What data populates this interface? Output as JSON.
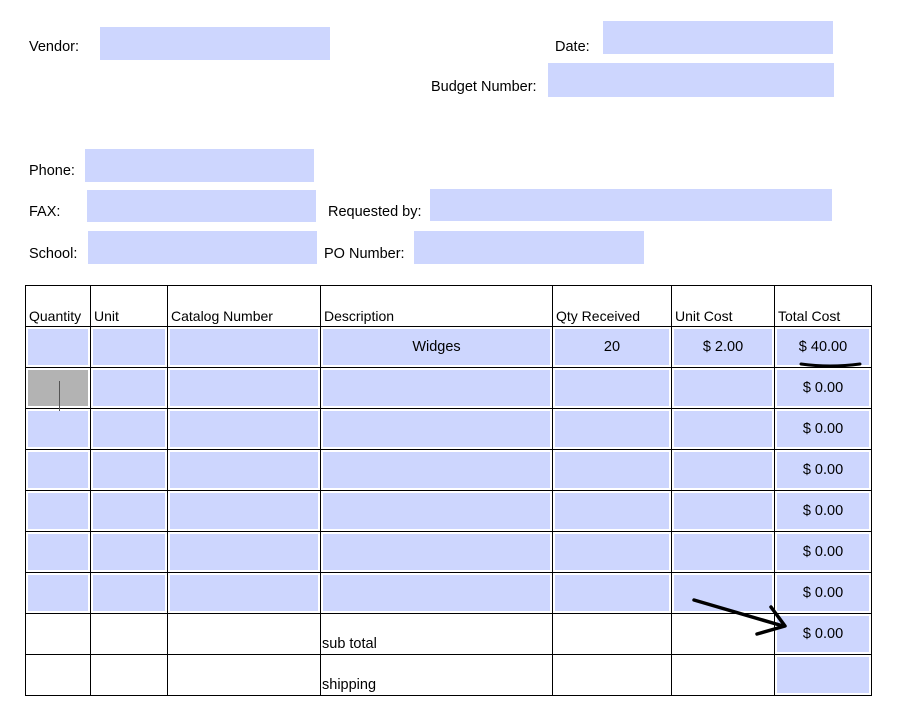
{
  "header": {
    "vendor_label": "Vendor:",
    "date_label": "Date:",
    "budget_label": "Budget Number:",
    "phone_label": "Phone:",
    "fax_label": "FAX:",
    "requested_label": "Requested by:",
    "school_label": "School:",
    "po_label": "PO Number:",
    "vendor_value": "",
    "date_value": "",
    "budget_value": "",
    "phone_value": "",
    "fax_value": "",
    "requested_value": "",
    "school_value": "",
    "po_value": ""
  },
  "table": {
    "columns": [
      "Quantity",
      "Unit",
      "Catalog Number",
      "Description",
      "Qty Received",
      "Unit Cost",
      "Total Cost"
    ],
    "rows": [
      {
        "quantity": "",
        "unit": "",
        "catalog": "",
        "description": "Widges",
        "qty_received": "20",
        "unit_cost": "$ 2.00",
        "total": "$ 40.00"
      },
      {
        "quantity": "",
        "unit": "",
        "catalog": "",
        "description": "",
        "qty_received": "",
        "unit_cost": "",
        "total": "$ 0.00"
      },
      {
        "quantity": "",
        "unit": "",
        "catalog": "",
        "description": "",
        "qty_received": "",
        "unit_cost": "",
        "total": "$ 0.00"
      },
      {
        "quantity": "",
        "unit": "",
        "catalog": "",
        "description": "",
        "qty_received": "",
        "unit_cost": "",
        "total": "$ 0.00"
      },
      {
        "quantity": "",
        "unit": "",
        "catalog": "",
        "description": "",
        "qty_received": "",
        "unit_cost": "",
        "total": "$ 0.00"
      },
      {
        "quantity": "",
        "unit": "",
        "catalog": "",
        "description": "",
        "qty_received": "",
        "unit_cost": "",
        "total": "$ 0.00"
      },
      {
        "quantity": "",
        "unit": "",
        "catalog": "",
        "description": "",
        "qty_received": "",
        "unit_cost": "",
        "total": "$ 0.00"
      }
    ],
    "subtotal_label": "sub total",
    "subtotal_value": "$ 0.00",
    "shipping_label": "shipping",
    "shipping_value": ""
  },
  "colors": {
    "field_fill": "#cdd6fe",
    "active_field_fill": "#b3b3b3",
    "annotation_ink": "#000000"
  }
}
